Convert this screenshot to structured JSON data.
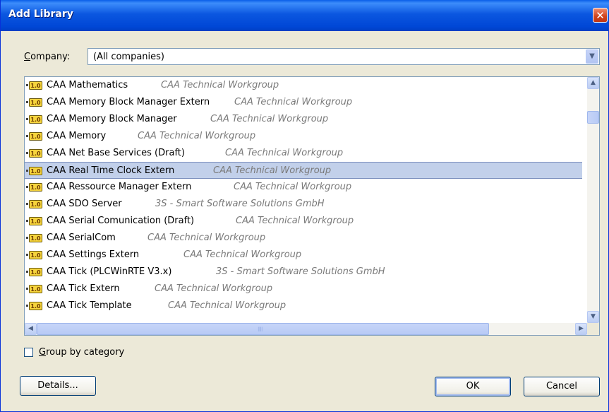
{
  "window": {
    "title": "Add Library",
    "close_glyph": "✕"
  },
  "company": {
    "label": "Company:",
    "mnemonic": "C",
    "label_rest": "ompany:",
    "value": "(All companies)"
  },
  "libraries": [
    {
      "name": "CAA Mathematics",
      "company": "CAA Technical Workgroup"
    },
    {
      "name": "CAA Memory Block Manager Extern",
      "company": "CAA Technical Workgroup"
    },
    {
      "name": "CAA Memory Block Manager",
      "company": "CAA Technical Workgroup"
    },
    {
      "name": "CAA Memory",
      "company": "CAA Technical Workgroup"
    },
    {
      "name": "CAA Net Base Services (Draft)",
      "company": "CAA Technical Workgroup"
    },
    {
      "name": "CAA Real Time Clock Extern",
      "company": "CAA Technical Workgroup",
      "selected": true
    },
    {
      "name": "CAA Ressource Manager Extern",
      "company": "CAA Technical Workgroup"
    },
    {
      "name": "CAA SDO Server",
      "company": "3S - Smart Software Solutions GmbH"
    },
    {
      "name": "CAA Serial Comunication (Draft)",
      "company": "CAA Technical Workgroup"
    },
    {
      "name": "CAA SerialCom",
      "company": "CAA Technical Workgroup"
    },
    {
      "name": "CAA Settings Extern",
      "company": "CAA Technical Workgroup"
    },
    {
      "name": "CAA Tick (PLCWinRTE V3.x)",
      "company": "3S - Smart Software Solutions GmbH"
    },
    {
      "name": "CAA Tick Extern",
      "company": "CAA Technical Workgroup"
    },
    {
      "name": "CAA Tick Template",
      "company": "CAA Technical Workgroup"
    }
  ],
  "library_icon_text": "1.0",
  "group_by_category": {
    "label": "Group by category",
    "mnemonic": "G",
    "label_rest": "roup by category",
    "checked": false
  },
  "buttons": {
    "details": "Details...",
    "ok": "OK",
    "cancel": "Cancel"
  },
  "colors": {
    "titlebar": "#0a5fe8",
    "selection": "#c2d0ea",
    "company_text": "#7a7a7a"
  }
}
